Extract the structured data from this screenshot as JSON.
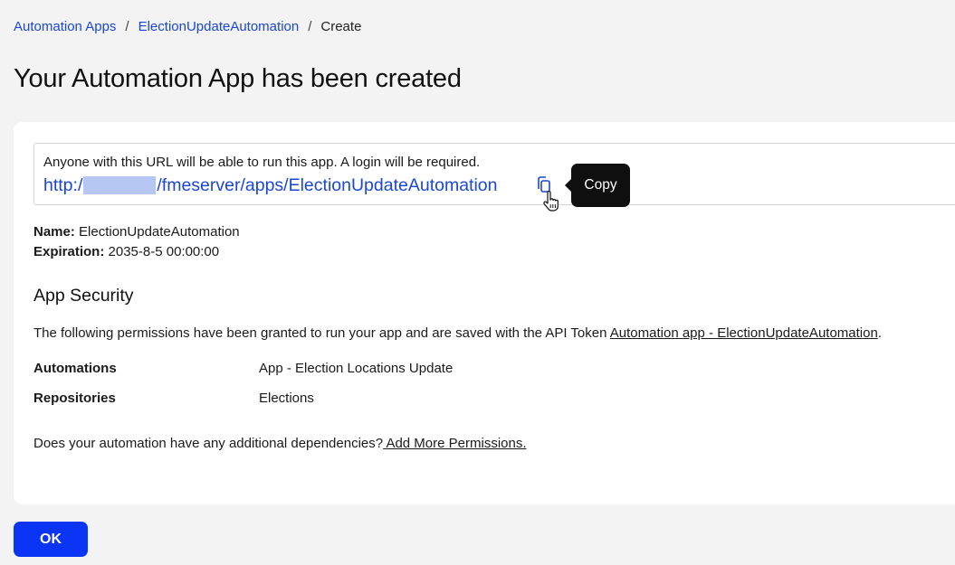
{
  "breadcrumb": {
    "items": [
      "Automation Apps",
      "ElectionUpdateAutomation"
    ],
    "current": "Create",
    "separator": "/"
  },
  "page_title": "Your Automation App has been created",
  "url_box": {
    "note": "Anyone with this URL will be able to run this app. A login will be required.",
    "url_prefix": "http:/",
    "url_suffix": "/fmeserver/apps/ElectionUpdateAutomation",
    "copy_icon": "copy-icon",
    "tooltip": "Copy"
  },
  "details": {
    "name_label": "Name:",
    "name_value": "ElectionUpdateAutomation",
    "expiration_label": "Expiration:",
    "expiration_value": "2035-8-5 00:00:00"
  },
  "security": {
    "title": "App Security",
    "text_before": "The following permissions have been granted to run your app and are saved with the API Token ",
    "token_link": "Automation app - ElectionUpdateAutomation",
    "text_after": ".",
    "permissions": [
      {
        "label": "Automations",
        "value": "App - Election Locations Update"
      },
      {
        "label": "Repositories",
        "value": "Elections"
      }
    ],
    "deps_text": "Does your automation have any additional dependencies?",
    "deps_link": " Add More Permissions."
  },
  "ok_button": "OK",
  "colors": {
    "link": "#1a47d6",
    "primary_button": "#0a35f5",
    "background": "#f3f3f3",
    "tooltip_bg": "#0f0f0f"
  }
}
